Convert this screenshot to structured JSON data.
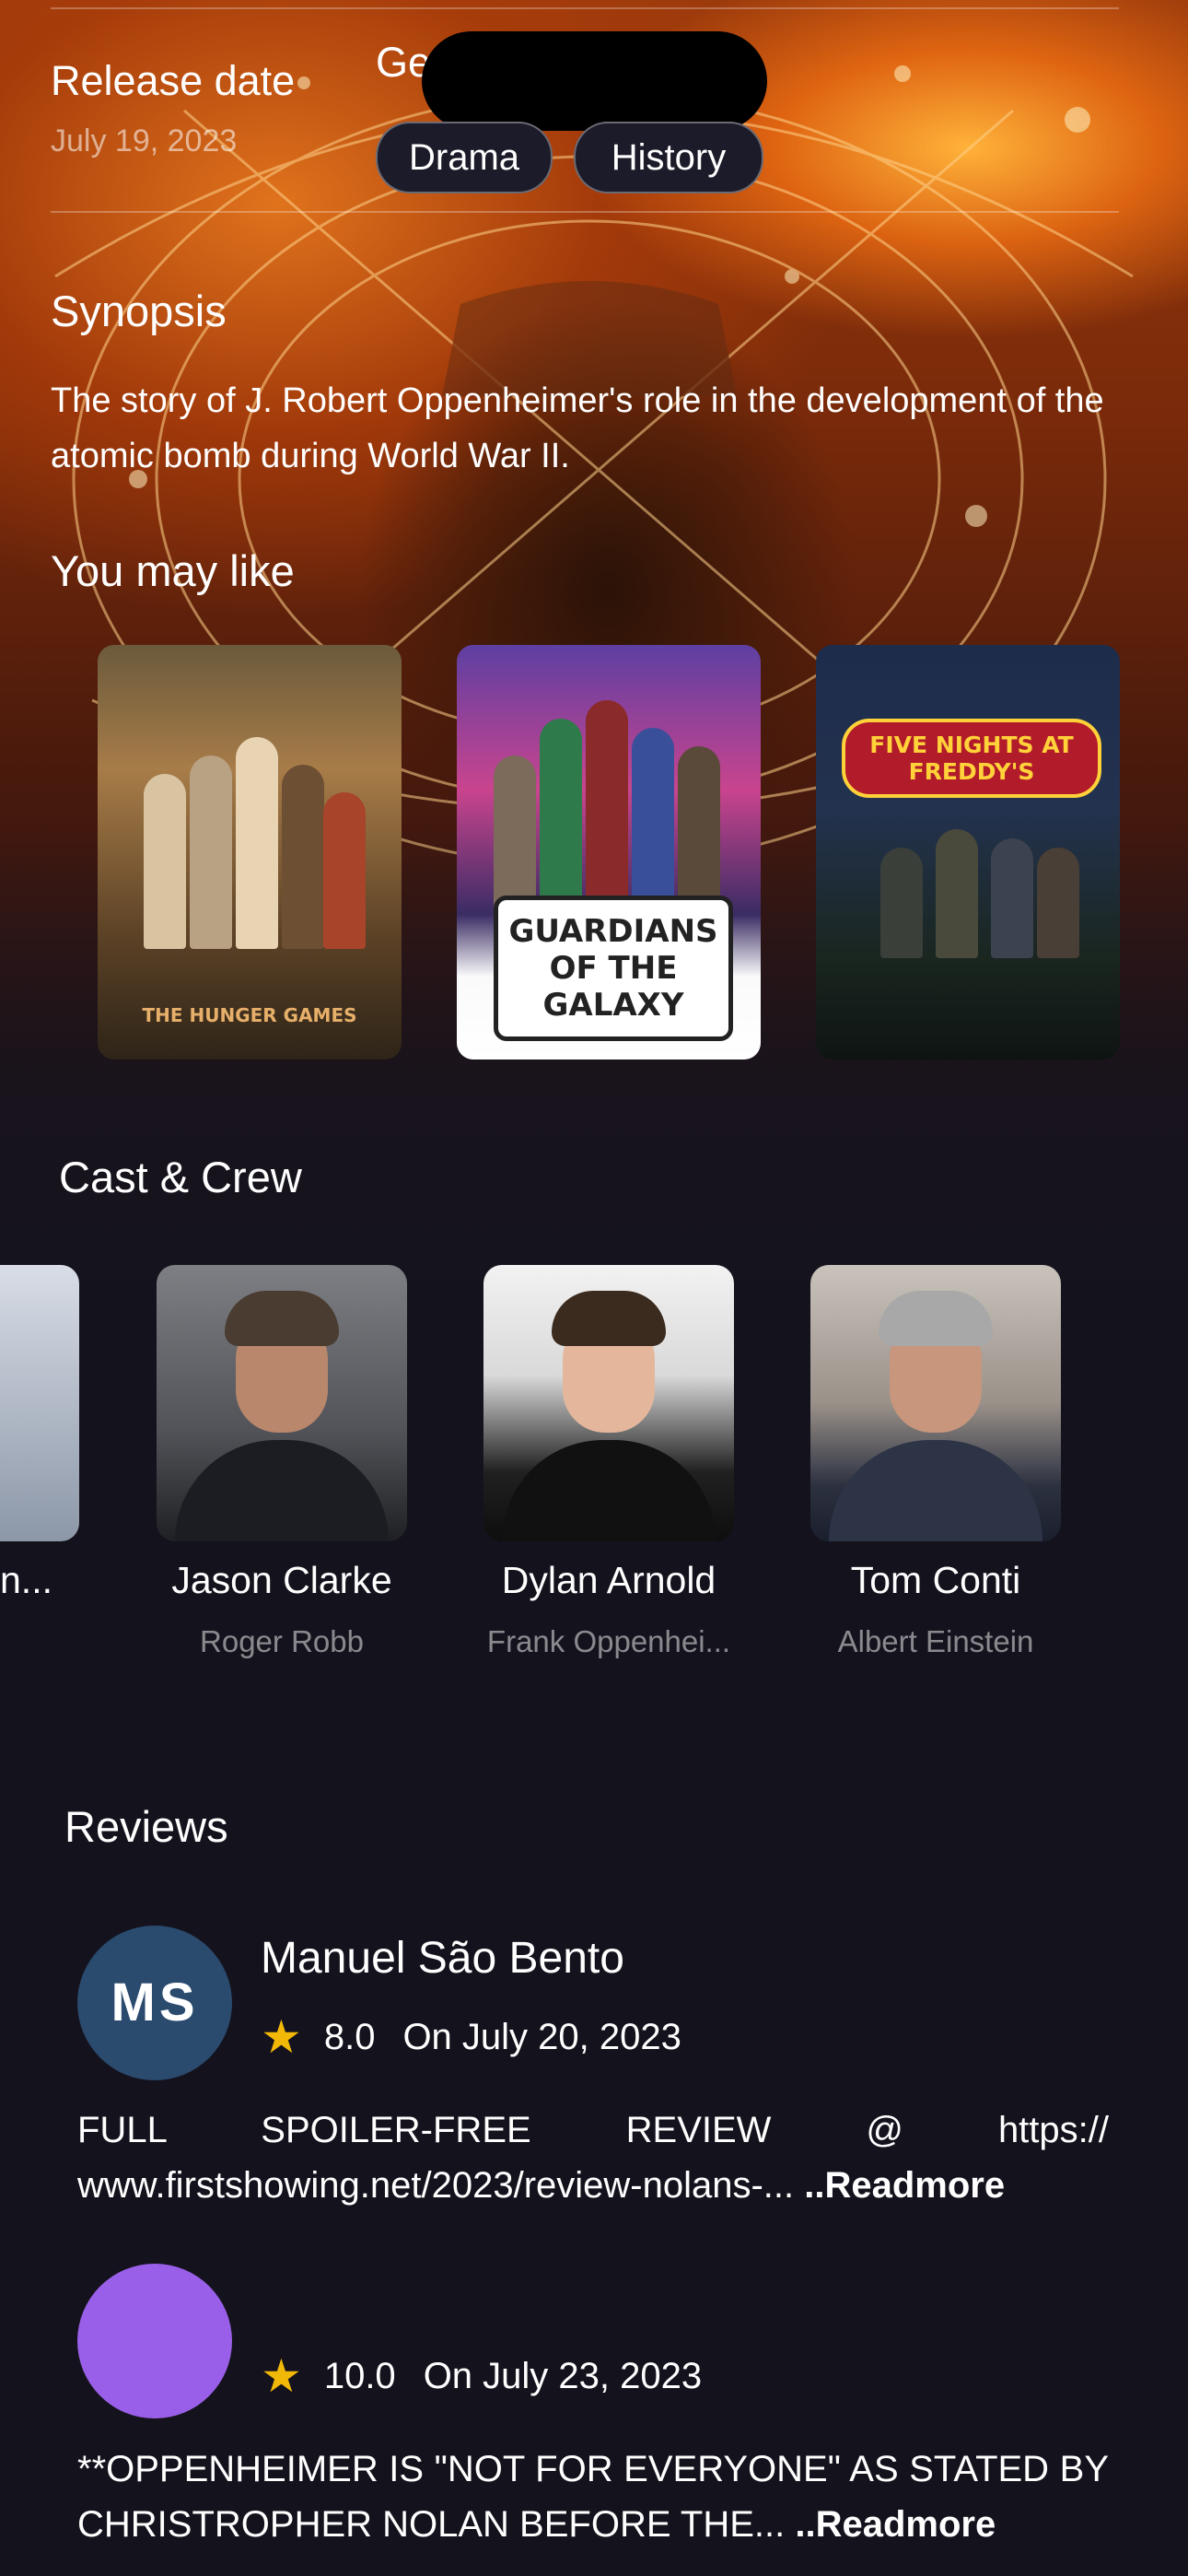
{
  "movie": {
    "release_label": "Release date",
    "release_date": "July 19, 2023",
    "genres_label": "Ge",
    "genres": [
      "Drama",
      "History"
    ],
    "synopsis_title": "Synopsis",
    "synopsis": "The story of J. Robert Oppenheimer's role in the development of the atomic bomb during World War II."
  },
  "recommendations": {
    "title": "You may like",
    "items": [
      {
        "caption": "THE HUNGER GAMES"
      },
      {
        "caption": "GUARDIANS OF THE GALAXY"
      },
      {
        "caption": "FIVE NIGHTS AT FREDDY'S"
      }
    ]
  },
  "cast": {
    "title": "Cast & Crew",
    "partial_name": "n...",
    "members": [
      {
        "name": "Jason Clarke",
        "role": "Roger Robb"
      },
      {
        "name": "Dylan Arnold",
        "role": "Frank Oppenhei..."
      },
      {
        "name": "Tom Conti",
        "role": "Albert Einstein"
      }
    ]
  },
  "reviews": {
    "title": "Reviews",
    "readmore_label": "..Readmore",
    "items": [
      {
        "initials": "MS",
        "author": "Manuel São Bento",
        "rating": "8.0",
        "date": "On July 20, 2023",
        "excerpt": "FULL SPOILER-FREE REVIEW @ https:// www.firstshowing.net/2023/review-nolans-..."
      },
      {
        "initials": "",
        "author": "",
        "rating": "10.0",
        "date": "On July 23, 2023",
        "excerpt": "**OPPENHEIMER IS \"NOT FOR EVERYONE\" AS STATED BY CHRISTROPHER NOLAN BEFORE THE..."
      }
    ]
  },
  "colors": {
    "background": "#14131d",
    "chip_bg": "#1c1b29",
    "star": "#f2b807",
    "avatar_ms": "#2a4a6e",
    "avatar_2": "#9a5fe8"
  }
}
